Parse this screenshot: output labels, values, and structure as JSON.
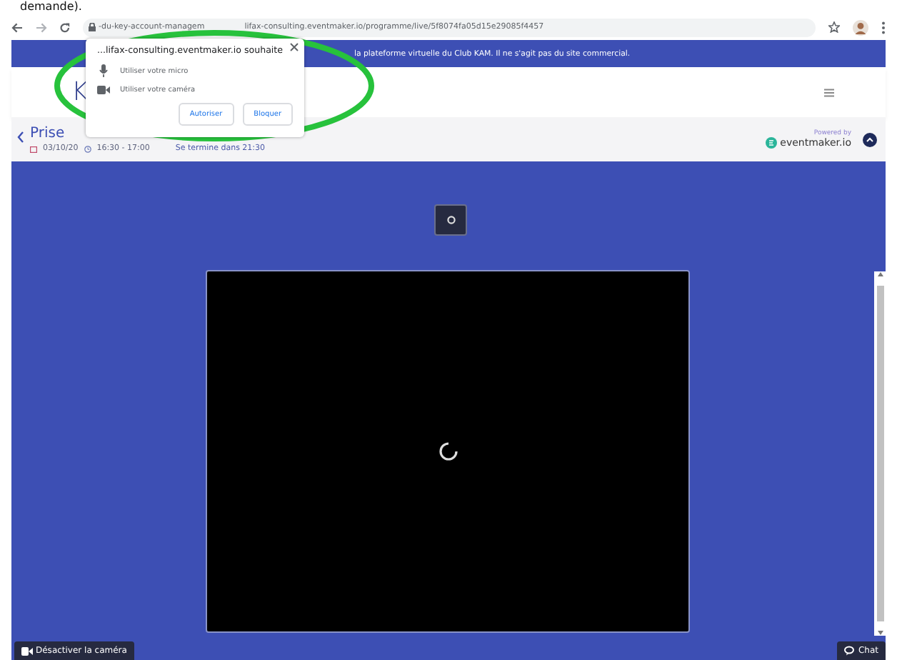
{
  "document_fragment": "demande).",
  "browser": {
    "url_start": "-du-key-account-managem",
    "url_end": "lifax-consulting.eventmaker.io/programme/live/5f8074fa05d15e29085f4457"
  },
  "banner": "la plateforme virtuelle du Club KAM. Il ne s'agit pas du site commercial.",
  "header": {
    "logo": "K"
  },
  "event": {
    "title": "Prise",
    "date": "03/10/20",
    "time": "16:30 - 17:00",
    "countdown": "Se termine dans 21:30",
    "powered_by": "Powered by",
    "brand": "eventmaker.io"
  },
  "stage": {
    "buttons": [
      {
        "kind": "camera",
        "label": "Désactiver la caméra"
      },
      {
        "kind": "chat",
        "label": "Chat"
      }
    ]
  },
  "permission_popup": {
    "title": "...lifax-consulting.eventmaker.io souhaite",
    "permissions": [
      {
        "kind": "microphone",
        "label": "Utiliser votre micro"
      },
      {
        "kind": "camera",
        "label": "Utiliser votre caméra"
      }
    ],
    "buttons": [
      "Autoriser",
      "Bloquer"
    ]
  }
}
